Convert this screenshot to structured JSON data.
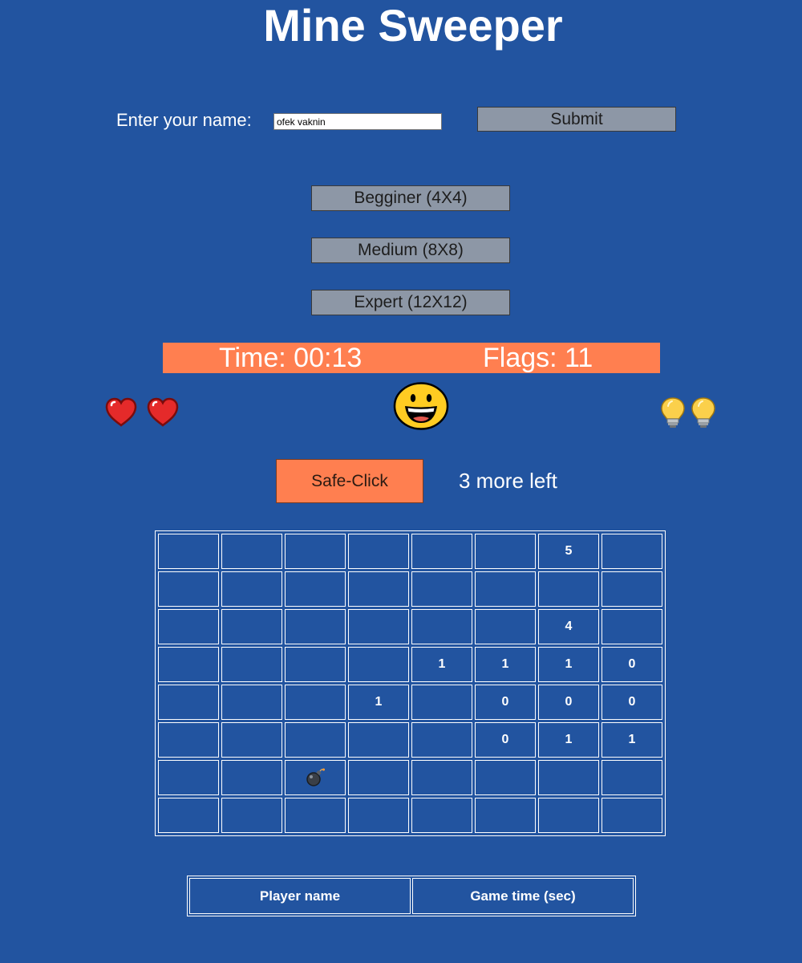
{
  "title": "Mine Sweeper",
  "name_form": {
    "label": "Enter your name:",
    "value": "ofek vaknin",
    "submit_label": "Submit"
  },
  "levels": {
    "beginner": "Begginer (4X4)",
    "medium": "Medium (8X8)",
    "expert": "Expert (12X12)"
  },
  "stats": {
    "time": "Time: 00:13",
    "flags": "Flags: 11"
  },
  "lives": {
    "count": 2,
    "icon": "heart-icon"
  },
  "hints": {
    "count": 2,
    "icon": "lightbulb-icon"
  },
  "face": {
    "icon": "smiley-face-icon",
    "state": "happy"
  },
  "safe_click": {
    "label": "Safe-Click",
    "remaining_text": "3 more left"
  },
  "board": {
    "rows": [
      [
        "",
        "",
        "",
        "",
        "",
        "",
        "5",
        ""
      ],
      [
        "",
        "",
        "",
        "",
        "",
        "",
        "",
        ""
      ],
      [
        "",
        "",
        "",
        "",
        "",
        "",
        "4",
        ""
      ],
      [
        "",
        "",
        "",
        "",
        "1",
        "1",
        "1",
        "0"
      ],
      [
        "",
        "",
        "",
        "1",
        "",
        "0",
        "0",
        "0"
      ],
      [
        "",
        "",
        "",
        "",
        "",
        "0",
        "1",
        "1"
      ],
      [
        "",
        "",
        "bomb",
        "",
        "",
        "",
        "",
        ""
      ],
      [
        "",
        "",
        "",
        "",
        "",
        "",
        "",
        ""
      ]
    ]
  },
  "scoreboard": {
    "headers": [
      "Player name",
      "Game time (sec)"
    ]
  },
  "colors": {
    "background": "#2254a0",
    "accent": "#ff7f50",
    "button_gray": "#8d97a6"
  }
}
